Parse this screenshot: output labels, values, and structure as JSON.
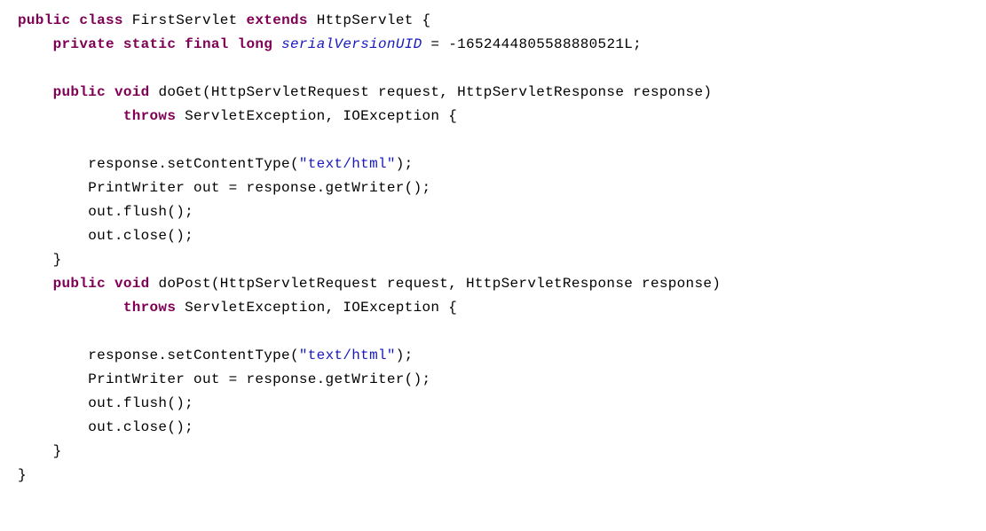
{
  "code": {
    "l1": {
      "k1": "public",
      "sp1": " ",
      "k2": "class",
      "sp2": " ",
      "cls": "FirstServlet",
      "sp3": " ",
      "k3": "extends",
      "sp4": " ",
      "sup": "HttpServlet {",
      "tail": ""
    },
    "l2": {
      "indent": "    ",
      "k1": "private",
      "sp1": " ",
      "k2": "static",
      "sp2": " ",
      "k3": "final",
      "sp3": " ",
      "k4": "long",
      "sp4": " ",
      "field": "serialVersionUID",
      "rest": " = -1652444805588880521L;"
    },
    "l3": {
      "text": ""
    },
    "l4": {
      "indent": "    ",
      "k1": "public",
      "sp1": " ",
      "k2": "void",
      "sp2": " ",
      "sig": "doGet(HttpServletRequest request, HttpServletResponse response)"
    },
    "l5": {
      "indent": "            ",
      "k1": "throws",
      "rest": " ServletException, IOException {"
    },
    "l6": {
      "text": ""
    },
    "l7": {
      "indent": "        ",
      "pre": "response.setContentType(",
      "str": "\"text/html\"",
      "post": ");"
    },
    "l8": {
      "indent": "        ",
      "text": "PrintWriter out = response.getWriter();"
    },
    "l9": {
      "indent": "        ",
      "text": "out.flush();"
    },
    "l10": {
      "indent": "        ",
      "text": "out.close();"
    },
    "l11": {
      "indent": "    ",
      "text": "}"
    },
    "l12": {
      "indent": "    ",
      "k1": "public",
      "sp1": " ",
      "k2": "void",
      "sp2": " ",
      "sig": "doPost(HttpServletRequest request, HttpServletResponse response)"
    },
    "l13": {
      "indent": "            ",
      "k1": "throws",
      "rest": " ServletException, IOException {"
    },
    "l14": {
      "text": ""
    },
    "l15": {
      "indent": "        ",
      "pre": "response.setContentType(",
      "str": "\"text/html\"",
      "post": ");"
    },
    "l16": {
      "indent": "        ",
      "text": "PrintWriter out = response.getWriter();"
    },
    "l17": {
      "indent": "        ",
      "text": "out.flush();"
    },
    "l18": {
      "indent": "        ",
      "text": "out.close();"
    },
    "l19": {
      "indent": "    ",
      "text": "}"
    },
    "l20": {
      "text": "}"
    }
  }
}
